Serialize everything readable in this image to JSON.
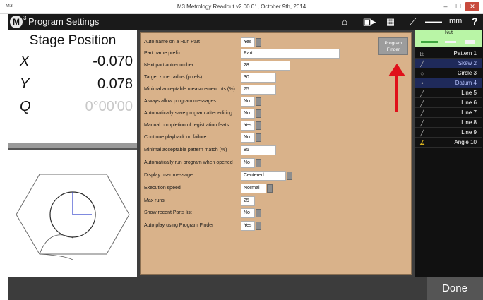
{
  "window": {
    "app_icon": "M3",
    "title": "M3 Metrology Readout  v2.00.01, October 9th, 2014",
    "minimize": "–",
    "maximize": "☐",
    "close": "✕"
  },
  "toolbar": {
    "logo": "M",
    "logo_sup": "3",
    "title": "Program Settings",
    "icons": [
      "home-icon",
      "video-icon",
      "grid-icon",
      "probe-icon",
      "ruler-icon"
    ],
    "units": "mm",
    "help": "?"
  },
  "dro": {
    "title": "Stage Position",
    "rows": [
      {
        "axis": "X",
        "value": "-0.070"
      },
      {
        "axis": "Y",
        "value": "0.078"
      },
      {
        "axis": "Q",
        "value": "0°00'00"
      }
    ]
  },
  "settings": {
    "program_finder": "Program Finder",
    "rows": [
      {
        "label": "Auto name on a Run Part",
        "value": "Yes"
      },
      {
        "label": "Part name prefix",
        "value": "Part"
      },
      {
        "label": "Next part auto-number",
        "value": "28"
      },
      {
        "label": "Target zone radius (pixels)",
        "value": "30"
      },
      {
        "label": "Minimal acceptable measurement pts (%)",
        "value": "75"
      },
      {
        "label": "Always allow program messages",
        "value": "No"
      },
      {
        "label": "Automatically save program after editing",
        "value": "No"
      },
      {
        "label": "Manual completion of registration feats",
        "value": "Yes"
      },
      {
        "label": "Continue playback on failure",
        "value": "No"
      },
      {
        "label": "Minimal acceptable pattern match (%)",
        "value": "85"
      },
      {
        "label": "Automatically run program when opened",
        "value": "No"
      },
      {
        "label": "Display user message",
        "value": "Centered"
      },
      {
        "label": "Execution speed",
        "value": "Normal"
      },
      {
        "label": "Max runs",
        "value": "25"
      },
      {
        "label": "Show recent Parts list",
        "value": "No"
      },
      {
        "label": "Auto play using Program Finder",
        "value": "Yes"
      }
    ]
  },
  "features": {
    "header": "Nut",
    "items": [
      {
        "icon": "pattern-icon",
        "label": "Pattern 1"
      },
      {
        "icon": "line-icon",
        "label": "Skew 2"
      },
      {
        "icon": "circle-icon",
        "label": "Circle 3"
      },
      {
        "icon": "point-icon",
        "label": "Datum 4"
      },
      {
        "icon": "line-icon",
        "label": "Line 5"
      },
      {
        "icon": "line-icon",
        "label": "Line 6"
      },
      {
        "icon": "line-icon",
        "label": "Line 7"
      },
      {
        "icon": "line-icon",
        "label": "Line 8"
      },
      {
        "icon": "line-icon",
        "label": "Line 9"
      },
      {
        "icon": "angle-icon",
        "label": "Angle 10"
      }
    ]
  },
  "footer": {
    "done": "Done"
  },
  "colors": {
    "settings_bg": "#d9b28a",
    "feature_header": "#b9f5a6",
    "selected_feature_text": "#b8c4ff",
    "arrow": "#e0101a"
  }
}
